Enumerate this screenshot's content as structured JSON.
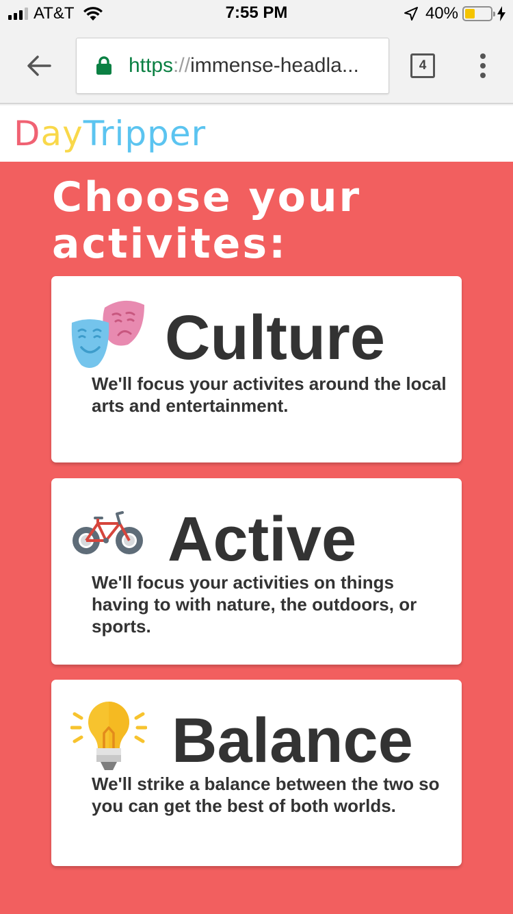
{
  "status_bar": {
    "carrier": "AT&T",
    "time": "7:55 PM",
    "battery_percent": "40%",
    "battery_level": 0.4,
    "signal_bars_on": 3,
    "signal_bars_total": 4
  },
  "browser": {
    "url_scheme": "https",
    "url_separator": "://",
    "url_host": "immense-headla...",
    "tab_count": "4"
  },
  "site": {
    "logo_parts": [
      "D",
      "ay",
      "Tripper"
    ],
    "logo_colors": [
      "#f06273",
      "#f9d84a",
      "#5bc4f0"
    ]
  },
  "main": {
    "heading": "Choose your activites:",
    "background_color": "#f25f5f",
    "cards": [
      {
        "title": "Culture",
        "icon": "theater-masks-icon",
        "description": "We'll focus your activites around the local arts and entertainment."
      },
      {
        "title": "Active",
        "icon": "bicycle-icon",
        "description": "We'll focus your activities on things having to with nature, the outdoors, or sports."
      },
      {
        "title": "Balance",
        "icon": "lightbulb-icon",
        "description": "We'll strike a balance between the two so you can get the best of both worlds."
      }
    ]
  }
}
